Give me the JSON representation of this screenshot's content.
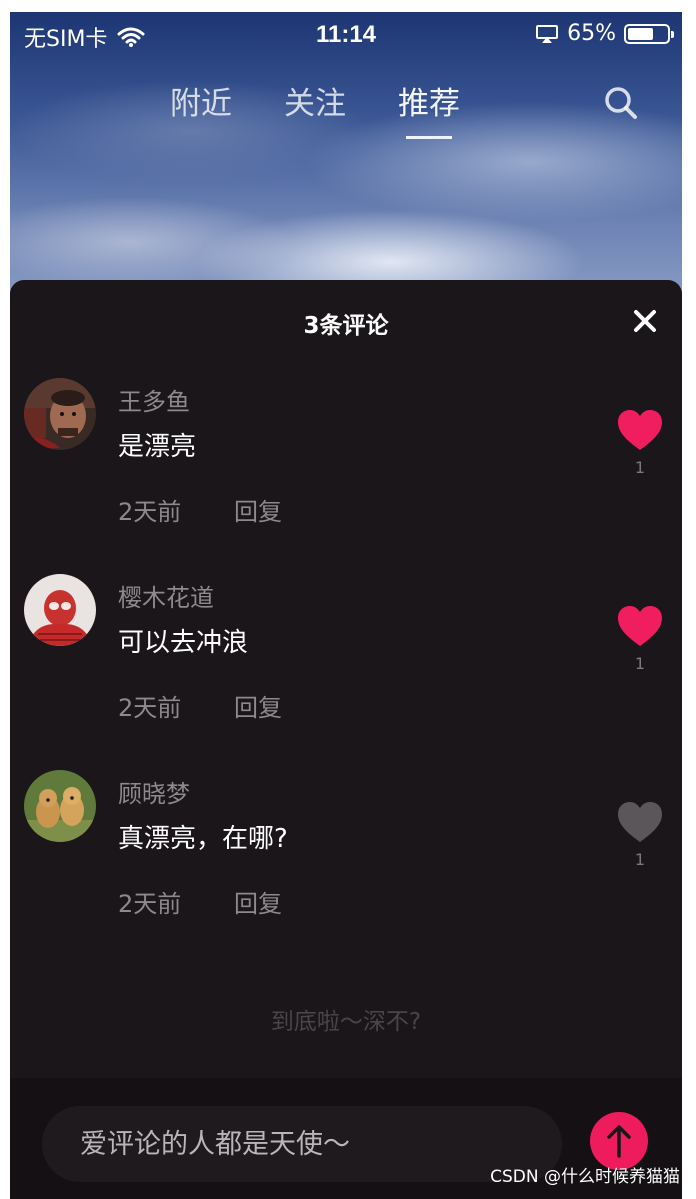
{
  "status_bar": {
    "carrier": "无SIM卡",
    "time": "11:14",
    "battery_percent": "65%",
    "battery_level": 0.65,
    "icons": [
      "wifi-icon",
      "airplay-icon",
      "battery-icon"
    ]
  },
  "top_tabs": {
    "items": [
      {
        "label": "附近",
        "active": false
      },
      {
        "label": "关注",
        "active": false
      },
      {
        "label": "推荐",
        "active": true
      }
    ],
    "search_icon": "search-icon"
  },
  "comments_sheet": {
    "title": "3条评论",
    "close_icon": "close-icon",
    "comments": [
      {
        "user": "王多鱼",
        "text": "是漂亮",
        "time": "2天前",
        "reply_label": "回复",
        "likes": "1",
        "liked": true,
        "avatar": "avatar-iron-man"
      },
      {
        "user": "樱木花道",
        "text": "可以去冲浪",
        "time": "2天前",
        "reply_label": "回复",
        "likes": "1",
        "liked": true,
        "avatar": "avatar-spider-man"
      },
      {
        "user": "顾晓梦",
        "text": "真漂亮，在哪?",
        "time": "2天前",
        "reply_label": "回复",
        "likes": "1",
        "liked": false,
        "avatar": "avatar-dogs"
      }
    ],
    "end_text": "到底啦～深不?",
    "input_placeholder": "爱评论的人都是天使～",
    "send_icon": "arrow-up-icon"
  },
  "colors": {
    "accent": "#ef1c5d",
    "like_active": "#f01e5e",
    "like_inactive": "#5a5659",
    "sheet_bg": "#1a1619"
  },
  "watermark": "CSDN @什么时候养猫猫"
}
